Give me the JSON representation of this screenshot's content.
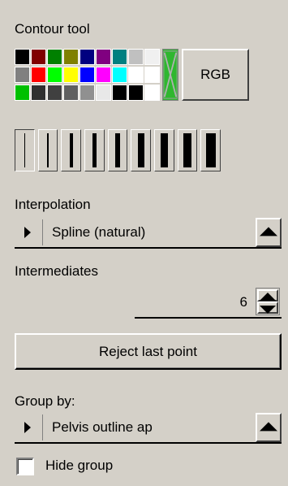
{
  "contour_tool": {
    "title": "Contour tool",
    "palette": [
      "#000000",
      "#800000",
      "#008000",
      "#808000",
      "#000080",
      "#800080",
      "#008080",
      "#c0c0c0",
      "#f0f0f0",
      "#808080",
      "#ff0000",
      "#00ff00",
      "#ffff00",
      "#0000ff",
      "#ff00ff",
      "#00ffff",
      "#ffffff",
      "#ffffff",
      "#00c000",
      "#303030",
      "#404040",
      "#606060",
      "#909090",
      "#e8e8e8",
      "#000000",
      "#000000",
      "#ffffff"
    ],
    "transparent_swatch_icon": "no-color-cross-icon",
    "rgb_button_label": "RGB"
  },
  "line_widths": {
    "count": 9,
    "selected_index": 0,
    "widths": [
      1,
      2,
      3,
      4,
      5,
      6,
      7,
      8,
      9
    ]
  },
  "interpolation": {
    "label": "Interpolation",
    "value": "Spline (natural)",
    "expand_icon": "triangle-right-icon",
    "button_icon": "triangle-up-icon"
  },
  "intermediates": {
    "label": "Intermediates",
    "value": "6",
    "spin_up_icon": "triangle-up-icon",
    "spin_down_icon": "triangle-down-icon"
  },
  "reject_button": {
    "label": "Reject last point"
  },
  "group_by": {
    "label": "Group by:",
    "value": "Pelvis outline ap",
    "expand_icon": "triangle-right-icon",
    "button_icon": "triangle-up-icon"
  },
  "hide_group": {
    "label": "Hide group",
    "checked": false
  }
}
